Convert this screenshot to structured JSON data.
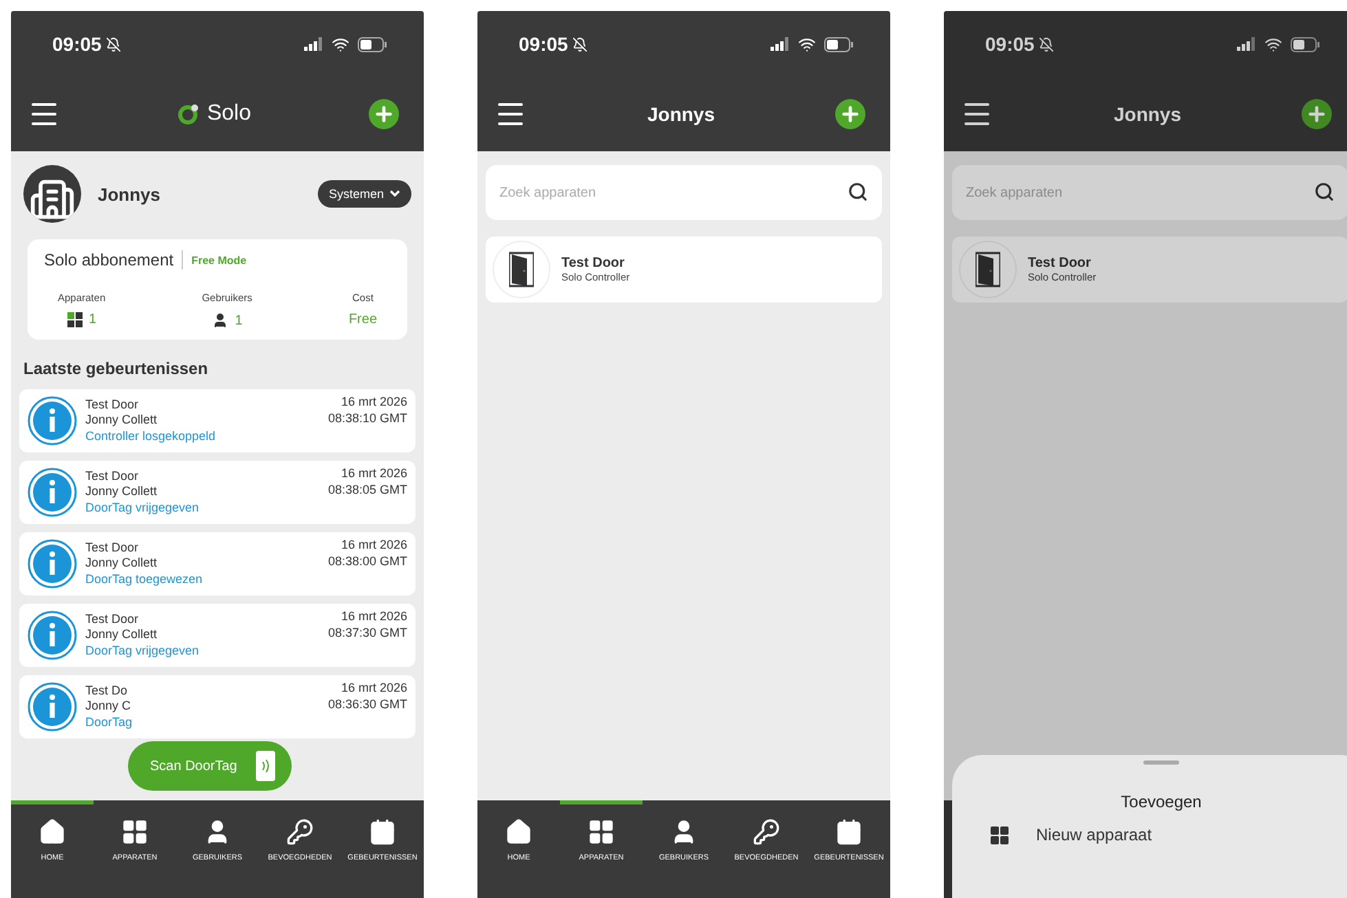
{
  "screens": [
    {
      "kind": "home",
      "status": {
        "time": "09:05"
      },
      "header": {
        "kind": "logo",
        "title": "Solo"
      },
      "profile": {
        "name": "Jonnys",
        "systems_button": "Systemen"
      },
      "subscription": {
        "title": "Solo abbonement",
        "mode": "Free Mode",
        "stats": [
          {
            "label": "Apparaten",
            "value": "1"
          },
          {
            "label": "Gebruikers",
            "value": "1"
          },
          {
            "label": "Cost",
            "value": "Free"
          }
        ]
      },
      "events_title": "Laatste gebeurtenissen",
      "events": [
        {
          "title": "Test Door",
          "user": "Jonny Collett",
          "action": "Controller losgekoppeld",
          "date": "16 mrt 2026",
          "time": "08:38:10 GMT"
        },
        {
          "title": "Test Door",
          "user": "Jonny Collett",
          "action": "DoorTag vrijgegeven",
          "date": "16 mrt 2026",
          "time": "08:38:05 GMT"
        },
        {
          "title": "Test Door",
          "user": "Jonny Collett",
          "action": "DoorTag toegewezen",
          "date": "16 mrt 2026",
          "time": "08:38:00 GMT"
        },
        {
          "title": "Test Door",
          "user": "Jonny Collett",
          "action": "DoorTag vrijgegeven",
          "date": "16 mrt 2026",
          "time": "08:37:30 GMT"
        },
        {
          "title": "Test Do",
          "user": "Jonny C",
          "action": "DoorTag",
          "date": "16 mrt 2026",
          "time": "08:36:30 GMT"
        }
      ],
      "scan_button": "Scan DoorTag",
      "nav": [
        {
          "label": "HOME",
          "selected": true
        },
        {
          "label": "APPARATEN",
          "selected": false
        },
        {
          "label": "GEBRUIKERS",
          "selected": false
        },
        {
          "label": "BEVOEGDHEDEN",
          "selected": false
        },
        {
          "label": "GEBEURTENISSEN",
          "selected": false
        }
      ]
    },
    {
      "kind": "devices",
      "status": {
        "time": "09:05"
      },
      "header": {
        "kind": "title",
        "title": "Jonnys"
      },
      "dimmed": false,
      "search": {
        "placeholder": "Zoek apparaten"
      },
      "devices": [
        {
          "name": "Test Door",
          "type": "Solo Controller"
        }
      ],
      "nav": [
        {
          "label": "HOME",
          "selected": false
        },
        {
          "label": "APPARATEN",
          "selected": true
        },
        {
          "label": "GEBRUIKERS",
          "selected": false
        },
        {
          "label": "BEVOEGDHEDEN",
          "selected": false
        },
        {
          "label": "GEBEURTENISSEN",
          "selected": false
        }
      ]
    },
    {
      "kind": "devices",
      "status": {
        "time": "09:05"
      },
      "header": {
        "kind": "title",
        "title": "Jonnys"
      },
      "dimmed": true,
      "search": {
        "placeholder": "Zoek apparaten"
      },
      "devices": [
        {
          "name": "Test Door",
          "type": "Solo Controller"
        }
      ],
      "sheet": {
        "title": "Toevoegen",
        "items": [
          "Nieuw apparaat"
        ]
      }
    }
  ]
}
